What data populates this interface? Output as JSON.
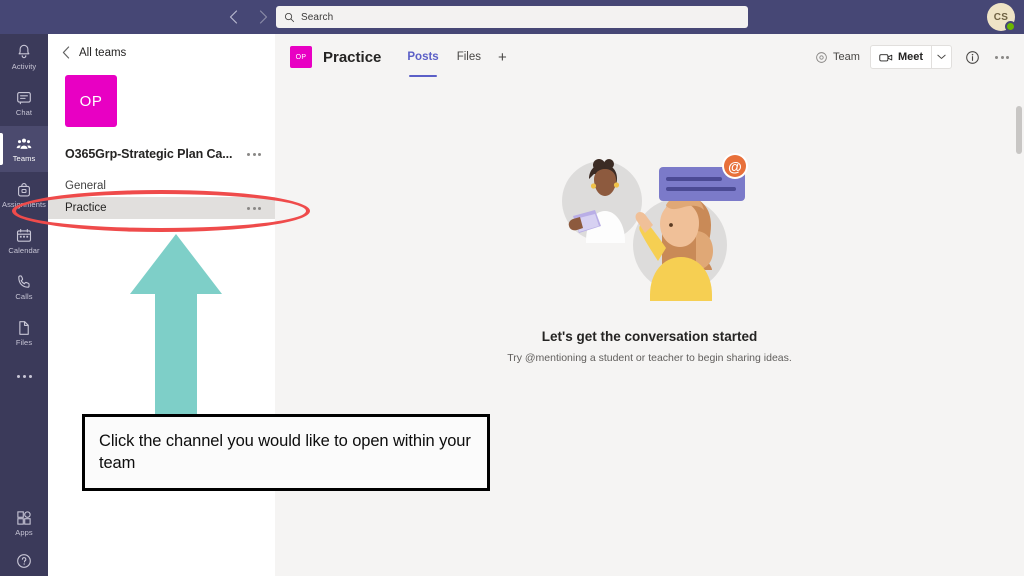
{
  "topbar": {
    "back_icon": "chevron-left-icon",
    "forward_icon": "chevron-right-icon",
    "search": {
      "placeholder": "Search",
      "value": "",
      "icon": "search-icon"
    },
    "avatar": {
      "initials": "CS",
      "presence": "available",
      "presence_color": "#6bb700"
    },
    "background_color": "#464775"
  },
  "rail": {
    "items": [
      {
        "label": "Activity",
        "icon": "bell-icon",
        "active": false
      },
      {
        "label": "Chat",
        "icon": "chat-bubble-icon",
        "active": false
      },
      {
        "label": "Teams",
        "icon": "people-icon",
        "active": true
      },
      {
        "label": "Assignments",
        "icon": "backpack-icon",
        "active": false
      },
      {
        "label": "Calendar",
        "icon": "calendar-icon",
        "active": false
      },
      {
        "label": "Calls",
        "icon": "phone-icon",
        "active": false
      },
      {
        "label": "Files",
        "icon": "file-icon",
        "active": false
      }
    ],
    "more_icon": "more-dots-icon",
    "bottom_items": [
      {
        "label": "Apps",
        "icon": "apps-grid-icon"
      },
      {
        "label": "",
        "icon": "help-question-icon"
      }
    ],
    "background_color": "#3b3a5a"
  },
  "panel": {
    "back_label": "All teams",
    "back_icon": "chevron-left-icon",
    "team": {
      "avatar_initials": "OP",
      "avatar_color": "#e800c3",
      "name": "O365Grp-Strategic Plan Ca...",
      "more_icon": "more-dots-icon"
    },
    "channels": [
      {
        "name": "General",
        "selected": false,
        "has_more": false
      },
      {
        "name": "Practice",
        "selected": true,
        "has_more": true
      }
    ]
  },
  "main": {
    "header": {
      "avatar_initials": "OP",
      "avatar_color": "#e800c3",
      "title": "Practice",
      "tabs": [
        {
          "label": "Posts",
          "active": true
        },
        {
          "label": "Files",
          "active": false
        }
      ],
      "add_tab_label": "+",
      "team_chip": {
        "label": "Team",
        "icon": "target-eye-icon"
      },
      "meet_button": {
        "label": "Meet",
        "icon": "camera-icon",
        "chevron": "chevron-down-icon"
      },
      "info_icon": "info-circle-icon",
      "more_icon": "more-dots-icon"
    },
    "empty_state": {
      "illustration": "two-people-at-mention-illustration",
      "title": "Let's get the conversation started",
      "subtitle": "Try @mentioning a student or teacher to begin sharing ideas."
    }
  },
  "annotations": {
    "ellipse": {
      "shape": "ellipse",
      "color": "#ef4b4b",
      "target": "Practice channel"
    },
    "arrow": {
      "shape": "arrow-up",
      "color": "#7ecfc8"
    },
    "callout": {
      "text": "Click the channel you would like to open within your team",
      "border_color": "#000000",
      "background_color": "#fbfbfb"
    }
  }
}
